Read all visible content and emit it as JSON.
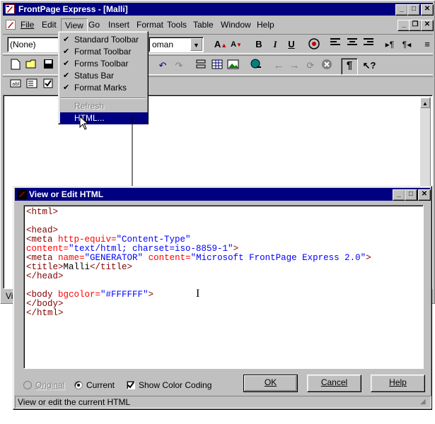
{
  "window": {
    "title": "FrontPage Express - [Malli]"
  },
  "menubar": {
    "items": [
      "File",
      "Edit",
      "View",
      "Go",
      "Insert",
      "Format",
      "Tools",
      "Table",
      "Window",
      "Help"
    ]
  },
  "format_toolbar": {
    "style_value": "(None)",
    "font_value": "oman"
  },
  "view_menu": {
    "items": [
      {
        "label": "Standard Toolbar",
        "checked": true
      },
      {
        "label": "Format Toolbar",
        "checked": true
      },
      {
        "label": "Forms Toolbar",
        "checked": true
      },
      {
        "label": "Status Bar",
        "checked": true
      },
      {
        "label": "Format Marks",
        "checked": true
      }
    ],
    "refresh_label": "Refresh",
    "html_label": "HTML..."
  },
  "dialog": {
    "title": "View or Edit HTML",
    "code_lines": [
      {
        "parts": [
          {
            "t": "tag",
            "s": "<html>"
          }
        ]
      },
      {
        "parts": []
      },
      {
        "parts": [
          {
            "t": "tag",
            "s": "<head>"
          }
        ]
      },
      {
        "parts": [
          {
            "t": "tag",
            "s": "<meta "
          },
          {
            "t": "attr",
            "s": "http-equiv="
          },
          {
            "t": "val",
            "s": "\"Content-Type\""
          }
        ]
      },
      {
        "parts": [
          {
            "t": "attr",
            "s": "content="
          },
          {
            "t": "val",
            "s": "\"text/html; charset=iso-8859-1\""
          },
          {
            "t": "tag",
            "s": ">"
          }
        ]
      },
      {
        "parts": [
          {
            "t": "tag",
            "s": "<meta "
          },
          {
            "t": "attr",
            "s": "name="
          },
          {
            "t": "val",
            "s": "\"GENERATOR\""
          },
          {
            "t": "tag",
            "s": " "
          },
          {
            "t": "attr",
            "s": "content="
          },
          {
            "t": "val",
            "s": "\"Microsoft FrontPage Express 2.0\""
          },
          {
            "t": "tag",
            "s": ">"
          }
        ]
      },
      {
        "parts": [
          {
            "t": "tag",
            "s": "<title>"
          },
          {
            "t": "txt",
            "s": "Malli"
          },
          {
            "t": "tag",
            "s": "</title>"
          }
        ]
      },
      {
        "parts": [
          {
            "t": "tag",
            "s": "</head>"
          }
        ]
      },
      {
        "parts": []
      },
      {
        "parts": [
          {
            "t": "tag",
            "s": "<body "
          },
          {
            "t": "attr",
            "s": "bgcolor="
          },
          {
            "t": "val",
            "s": "\"#FFFFFF\""
          },
          {
            "t": "tag",
            "s": ">"
          }
        ]
      },
      {
        "parts": [
          {
            "t": "tag",
            "s": "</body>"
          }
        ]
      },
      {
        "parts": [
          {
            "t": "tag",
            "s": "</html>"
          }
        ]
      }
    ],
    "radio_original": "Original",
    "radio_current": "Current",
    "checkbox_color_coding": "Show Color Coding",
    "ok_label": "OK",
    "cancel_label": "Cancel",
    "help_label": "Help",
    "status_text": "View or edit the current HTML"
  },
  "colors": {
    "titlebar": "#000080",
    "face": "#c0c0c0",
    "tag": "#800000",
    "attr": "#ff0000",
    "value": "#0000ff"
  }
}
